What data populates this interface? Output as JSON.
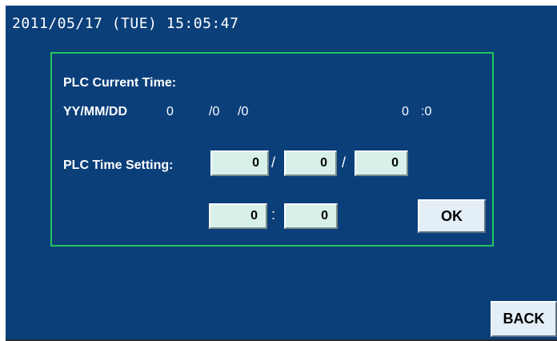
{
  "status_bar": {
    "datetime": "2011/05/17 (TUE) 15:05:47"
  },
  "panel": {
    "current_time_label": "PLC Current Time:",
    "date_format_label": "YY/MM/DD",
    "current_year": "0",
    "current_month_sep": "/0",
    "current_day_sep": "/0",
    "current_hour": "0",
    "current_minute_sep": ":0",
    "setting_label": "PLC Time Setting:",
    "set_year": "0",
    "set_month": "0",
    "set_day": "0",
    "set_hour": "0",
    "set_minute": "0",
    "date_separator": "/",
    "time_separator": ":",
    "ok_label": "OK"
  },
  "back_label": "BACK",
  "colors": {
    "background": "#0b3f7a",
    "panel_border": "#22c55e",
    "field_bg": "#d7f1ea"
  }
}
